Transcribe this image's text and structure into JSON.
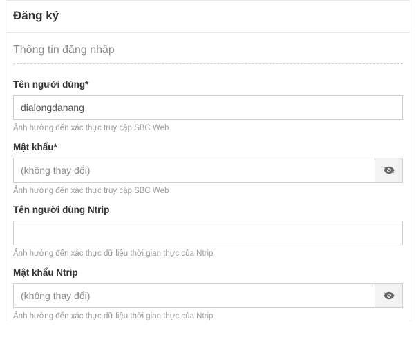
{
  "header": {
    "title": "Đăng ký"
  },
  "section": {
    "title": "Thông tin đăng nhập"
  },
  "fields": {
    "username": {
      "label": "Tên người dùng*",
      "value": "dialongdanang",
      "help": "Ảnh hưởng đến xác thực truy cập SBC Web"
    },
    "password": {
      "label": "Mật khẩu*",
      "placeholder": "(không thay đổi)",
      "help": "Ảnh hưởng đến xác thực truy cập SBC Web"
    },
    "ntrip_username": {
      "label": "Tên người dùng Ntrip",
      "value": "",
      "help": "Ảnh hưởng đến xác thực dữ liệu thời gian thực của Ntrip"
    },
    "ntrip_password": {
      "label": "Mật khẩu Ntrip",
      "placeholder": "(không thay đổi)",
      "help": "Ảnh hưởng đến xác thực dữ liệu thời gian thực của Ntrip"
    }
  }
}
